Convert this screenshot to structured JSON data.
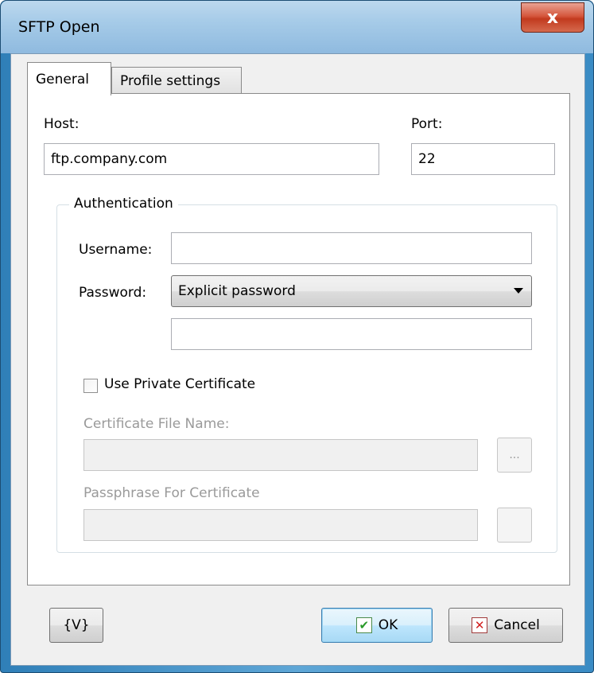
{
  "window": {
    "title": "SFTP Open",
    "close_glyph": "x"
  },
  "tabs": [
    {
      "label": "General",
      "active": true
    },
    {
      "label": "Profile settings",
      "active": false
    }
  ],
  "general": {
    "host_label": "Host:",
    "host_value": "ftp.company.com",
    "port_label": "Port:",
    "port_value": "22",
    "auth_group": "Authentication",
    "username_label": "Username:",
    "username_value": "",
    "password_label": "Password:",
    "password_mode": "Explicit password",
    "password_value": "",
    "use_cert_label": "Use Private Certificate",
    "use_cert_checked": false,
    "cert_file_label": "Certificate File Name:",
    "cert_file_value": "",
    "browse_label": "...",
    "passphrase_label": "Passphrase For Certificate",
    "passphrase_value": ""
  },
  "footer": {
    "variables_label": "{V}",
    "ok_label": "OK",
    "cancel_label": "Cancel"
  },
  "icons": [
    "close-icon",
    "dropdown-arrow-icon",
    "ok-check-icon",
    "cancel-x-icon"
  ]
}
